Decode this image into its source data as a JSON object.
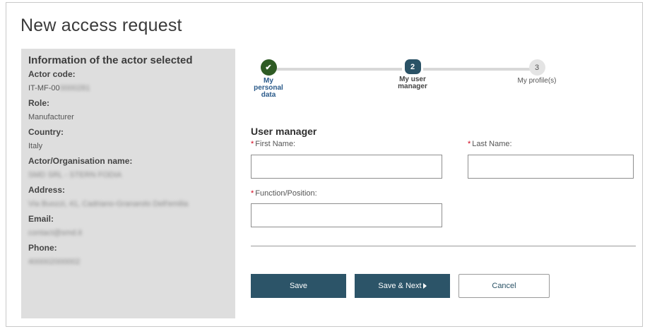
{
  "page": {
    "title": "New access request"
  },
  "actor_info": {
    "title": "Information of the actor selected",
    "fields": [
      {
        "label": "Actor code:",
        "value_prefix": "IT-MF-00",
        "value_blurred": "0000281"
      },
      {
        "label": "Role:",
        "value": "Manufacturer"
      },
      {
        "label": "Country:",
        "value": "Italy"
      },
      {
        "label": "Actor/Organisation name:",
        "value_blurred": "SMD SRL - STERN FODIA"
      },
      {
        "label": "Address:",
        "value_blurred": "Via Buozzi, 41, Cadriano-Granarolo Dell'emilia"
      },
      {
        "label": "Email:",
        "value_blurred": "contact@smd.it"
      },
      {
        "label": "Phone:",
        "value_blurred": "400002000002"
      }
    ]
  },
  "stepper": {
    "steps": [
      {
        "number": "✔",
        "label_line1": "My personal",
        "label_line2": "data",
        "state": "done"
      },
      {
        "number": "2",
        "label_line1": "My user",
        "label_line2": "manager",
        "state": "current"
      },
      {
        "number": "3",
        "label_line1": "My profile(s)",
        "label_line2": "",
        "state": "todo"
      }
    ]
  },
  "form": {
    "section_title": "User manager",
    "required_marker": "*",
    "first_name": {
      "label": "First Name:",
      "value": ""
    },
    "last_name": {
      "label": "Last Name:",
      "value": ""
    },
    "function_position": {
      "label": "Function/Position:",
      "value": ""
    }
  },
  "buttons": {
    "save": "Save",
    "save_next": "Save & Next",
    "cancel": "Cancel"
  },
  "colors": {
    "primary": "#2c5468",
    "step_done": "#2e5b24",
    "required": "#d0021b",
    "panel_bg": "#dedede"
  }
}
